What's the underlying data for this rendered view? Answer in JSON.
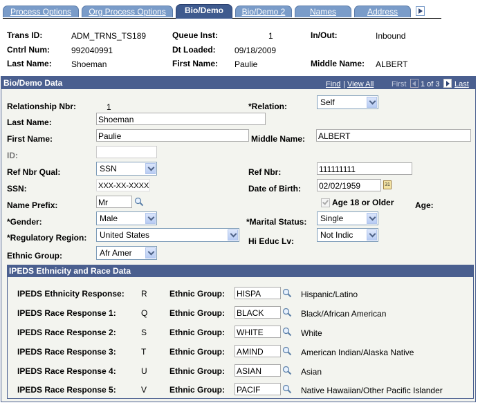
{
  "tabs": [
    {
      "label": "Process Options",
      "active": false
    },
    {
      "label": "Org Process Options",
      "active": false
    },
    {
      "label": "Bio/Demo",
      "active": true
    },
    {
      "label": "Bio/Demo 2",
      "active": false
    },
    {
      "label": "Names",
      "active": false
    },
    {
      "label": "Address",
      "active": false
    }
  ],
  "header": {
    "trans_id_label": "Trans ID:",
    "trans_id": "ADM_TRNS_TS189",
    "queue_inst_label": "Queue Inst:",
    "queue_inst": "1",
    "in_out_label": "In/Out:",
    "in_out": "Inbound",
    "cntrl_num_label": "Cntrl Num:",
    "cntrl_num": "992040991",
    "dt_loaded_label": "Dt Loaded:",
    "dt_loaded": "09/18/2009",
    "last_name_label": "Last Name:",
    "last_name": "Shoeman",
    "first_name_label": "First Name:",
    "first_name": "Paulie",
    "middle_name_label": "Middle Name:",
    "middle_name": "ALBERT"
  },
  "bio": {
    "title": "Bio/Demo Data",
    "find": "Find",
    "separator": "|",
    "view_all": "View All",
    "first": "First",
    "pager": "1 of 3",
    "last": "Last",
    "relationship_nbr_label": "Relationship Nbr:",
    "relationship_nbr": "1",
    "relation_label": "*Relation:",
    "relation": "Self",
    "last_name_label": "Last Name:",
    "last_name": "Shoeman",
    "first_name_label": "First Name:",
    "first_name": "Paulie",
    "middle_name_label": "Middle Name:",
    "middle_name": "ALBERT",
    "id_label": "ID:",
    "id": "",
    "ref_nbr_qual_label": "Ref Nbr Qual:",
    "ref_nbr_qual": "SSN",
    "ref_nbr_label": "Ref Nbr:",
    "ref_nbr": "111111111",
    "ssn_label": "SSN:",
    "ssn": "XXX-XX-XXXX",
    "dob_label": "Date of Birth:",
    "dob": "02/02/1959",
    "calendar_glyph": "31",
    "name_prefix_label": "Name Prefix:",
    "name_prefix": "Mr",
    "age18_label": "Age 18 or Older",
    "age18_checked": true,
    "age_label": "Age:",
    "gender_label": "*Gender:",
    "gender": "Male",
    "marital_label": "*Marital Status:",
    "marital": "Single",
    "reg_region_label": "*Regulatory Region:",
    "reg_region": "United States",
    "hi_educ_label": "Hi Educ Lv:",
    "hi_educ": "Not Indic",
    "ethnic_group_label": "Ethnic Group:",
    "ethnic_group": "Afr Amer"
  },
  "ipeds": {
    "title": "IPEDS Ethnicity and Race Data",
    "eg_label": "Ethnic Group:",
    "rows": [
      {
        "label": "IPEDS Ethnicity Response:",
        "code": "R",
        "group": "HISPA",
        "desc": "Hispanic/Latino"
      },
      {
        "label": "IPEDS Race Response 1:",
        "code": "Q",
        "group": "BLACK",
        "desc": "Black/African American"
      },
      {
        "label": "IPEDS Race Response 2:",
        "code": "S",
        "group": "WHITE",
        "desc": "White"
      },
      {
        "label": "IPEDS Race Response 3:",
        "code": "T",
        "group": "AMIND",
        "desc": "American Indian/Alaska Native"
      },
      {
        "label": "IPEDS Race Response 4:",
        "code": "U",
        "group": "ASIAN",
        "desc": "Asian"
      },
      {
        "label": "IPEDS Race Response 5:",
        "code": "V",
        "group": "PACIF",
        "desc": "Native Hawaiian/Other Pacific Islander"
      }
    ]
  }
}
